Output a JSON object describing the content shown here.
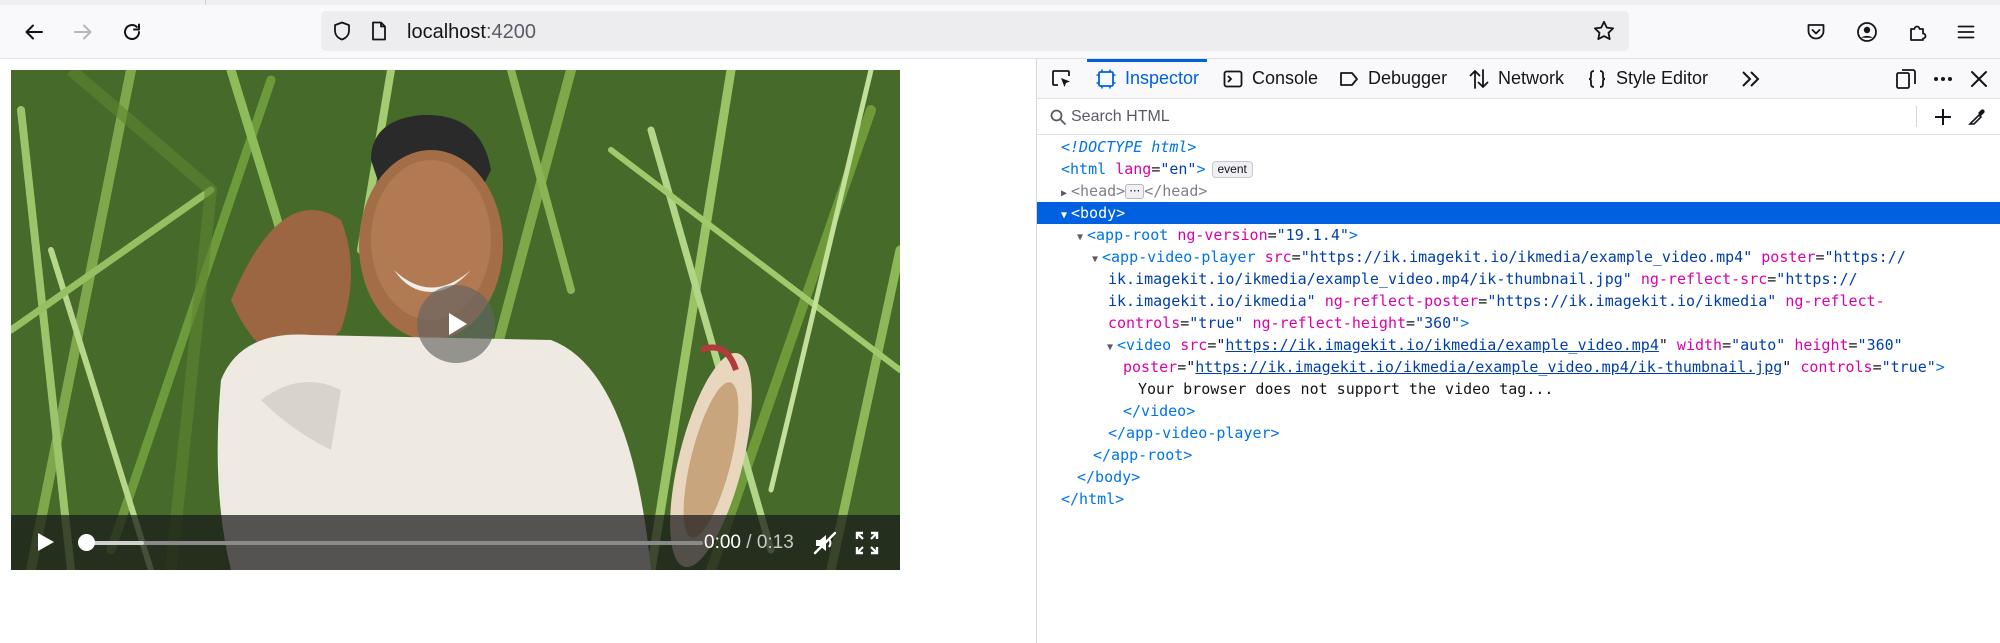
{
  "browser": {
    "url_host": "localhost",
    "url_port": ":4200",
    "icons": [
      "back-icon",
      "forward-icon",
      "reload-icon",
      "shield-icon",
      "page-icon",
      "bookmark-star-icon",
      "pocket-icon",
      "account-icon",
      "extensions-icon",
      "menu-icon"
    ]
  },
  "video_player": {
    "current_time": "0:00",
    "duration": "/ 0:13",
    "progress_fraction": 0,
    "icons": [
      "play-icon",
      "mute-icon",
      "fullscreen-icon"
    ]
  },
  "devtools": {
    "tabs": [
      {
        "label": "Inspector",
        "icon": "inspector-icon",
        "selected": true
      },
      {
        "label": "Console",
        "icon": "console-icon"
      },
      {
        "label": "Debugger",
        "icon": "debugger-icon"
      },
      {
        "label": "Network",
        "icon": "network-icon"
      },
      {
        "label": "Style Editor",
        "icon": "style-editor-icon"
      }
    ],
    "search_placeholder": "Search HTML",
    "tree": {
      "doctype": "<!DOCTYPE html>",
      "html_lang": "\"en\"",
      "event_badge": "event",
      "app_root_version": "\"19.1.4\"",
      "player_src": "\"https://ik.imagekit.io/ikmedia/example_video.mp4\"",
      "player_poster_1": "\"https://",
      "player_poster_2": "ik.imagekit.io/ikmedia/example_video.mp4/ik-thumbnail.jpg\"",
      "player_reflect_src_1": "\"https://",
      "player_reflect_src_2": "ik.imagekit.io/ikmedia\"",
      "player_reflect_poster": "\"https://ik.imagekit.io/ikmedia\"",
      "player_reflect_controls": "\"true\"",
      "player_reflect_height": "\"360\"",
      "video_src": "https://ik.imagekit.io/ikmedia/example_video.mp4",
      "video_width": "\"auto\"",
      "video_height": "\"360\"",
      "video_poster": "https://ik.imagekit.io/ikmedia/example_video.mp4/ik-thumbnail.jpg",
      "video_controls": "\"true\"",
      "video_text": "Your browser does not support the video tag..."
    }
  },
  "colors": {
    "accent": "#0061e0",
    "tag": "#0074e8",
    "attribute": "#dd00a9",
    "value": "#003eaa"
  }
}
